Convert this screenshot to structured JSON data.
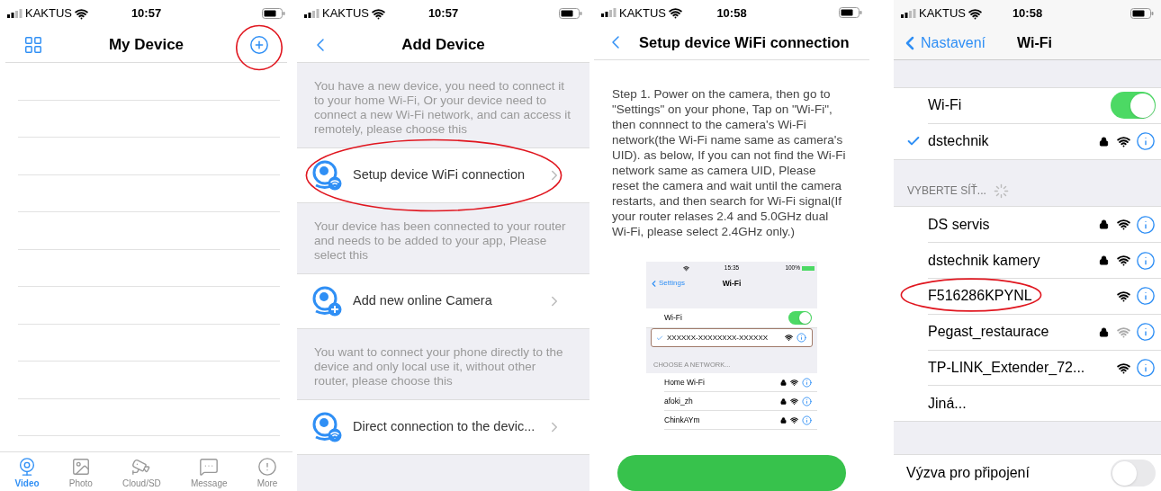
{
  "screens": [
    {
      "kind": "device_list",
      "status": {
        "carrier": "KAKTUS",
        "time": "10:57"
      },
      "title": "My Device",
      "add_circled": true,
      "tabs": [
        {
          "label": "Video",
          "selected": true
        },
        {
          "label": "Photo",
          "selected": false
        },
        {
          "label": "Cloud/SD",
          "selected": false
        },
        {
          "label": "Message",
          "selected": false
        },
        {
          "label": "More",
          "selected": false
        }
      ]
    },
    {
      "kind": "add_device",
      "status": {
        "carrier": "KAKTUS",
        "time": "10:57"
      },
      "title": "Add Device",
      "sections": [
        {
          "description": "You have a new device, you need to connect it to your home Wi-Fi, Or your device need to connect a new Wi-Fi network, and can access it remotely, please choose this",
          "option": "Setup device WiFi connection",
          "kind": "wifi",
          "circled": true
        },
        {
          "description": "Your device has been connected to your router and needs to be added to your app, Please select this",
          "option": "Add new online Camera",
          "kind": "plus",
          "circled": false
        },
        {
          "description": "You want to connect your phone directly to the device and only local use it, without other router, please choose this",
          "option": "Direct connection to the devic...",
          "kind": "wifi",
          "circled": false
        }
      ]
    },
    {
      "kind": "instructions",
      "status": {
        "carrier": "KAKTUS",
        "time": "10:58"
      },
      "title": "Setup device WiFi connection",
      "text": "Step 1. Power on the camera, then go to \"Settings\" on your phone, Tap on \"Wi-Fi\", then connnect to the camera's Wi-Fi network(the Wi-Fi name same as camera's UID). as below, If you can not find the Wi-Fi network same as camera UID, Please reset the camera and wait until the camera restarts, and then search for Wi-Fi signal(If your router relases 2.4 and 5.0GHz dual Wi-Fi, please select 2.4GHz only.)",
      "example": {
        "time": "15:35",
        "battery": "100%",
        "back": "Settings",
        "title": "Wi-Fi",
        "toggle_label": "Wi-Fi",
        "toggle_on": true,
        "connected": "XXXXXX-XXXXXXXX-XXXXXX",
        "section": "CHOOSE A NETWORK...",
        "networks": [
          {
            "name": "Home Wi-Fi",
            "locked": true
          },
          {
            "name": "afoki_zh",
            "locked": true
          },
          {
            "name": "ChinkAYm",
            "locked": true
          }
        ]
      }
    },
    {
      "kind": "wifi_settings",
      "status": {
        "carrier": "KAKTUS",
        "time": "10:58"
      },
      "back": "Nastavení",
      "title": "Wi-Fi",
      "toggle_label": "Wi-Fi",
      "toggle_on": true,
      "connected": "dstechnik",
      "connected_locked": true,
      "section": "VYBERTE SÍŤ...",
      "networks": [
        {
          "name": "DS servis",
          "locked": true,
          "weak": false,
          "circled": false
        },
        {
          "name": "dstechnik kamery",
          "locked": true,
          "weak": false,
          "circled": false
        },
        {
          "name": "F516286KPYNL",
          "locked": false,
          "weak": false,
          "circled": true
        },
        {
          "name": "Pegast_restaurace",
          "locked": true,
          "weak": true,
          "circled": false
        },
        {
          "name": "TP-LINK_Extender_72...",
          "locked": false,
          "weak": false,
          "circled": false
        }
      ],
      "other": "Jiná...",
      "ask": {
        "label": "Výzva pro připojení",
        "on": false
      }
    }
  ]
}
